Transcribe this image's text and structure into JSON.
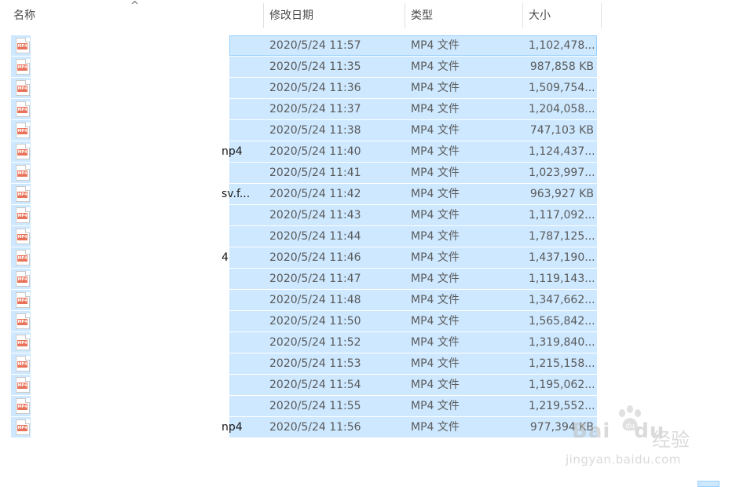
{
  "header": {
    "name": "名称",
    "date": "修改日期",
    "type": "类型",
    "size": "大小",
    "sort_glyph": "^"
  },
  "files": [
    {
      "name": "",
      "date": "2020/5/24 11:57",
      "type": "MP4 文件",
      "size": "1,102,478..."
    },
    {
      "name": "",
      "date": "2020/5/24 11:35",
      "type": "MP4 文件",
      "size": "987,858 KB"
    },
    {
      "name": "",
      "date": "2020/5/24 11:36",
      "type": "MP4 文件",
      "size": "1,509,754..."
    },
    {
      "name": "",
      "date": "2020/5/24 11:37",
      "type": "MP4 文件",
      "size": "1,204,058..."
    },
    {
      "name": "",
      "date": "2020/5/24 11:38",
      "type": "MP4 文件",
      "size": "747,103 KB"
    },
    {
      "name": "np4",
      "date": "2020/5/24 11:40",
      "type": "MP4 文件",
      "size": "1,124,437..."
    },
    {
      "name": "",
      "date": "2020/5/24 11:41",
      "type": "MP4 文件",
      "size": "1,023,997..."
    },
    {
      "name": "sv.f...",
      "date": "2020/5/24 11:42",
      "type": "MP4 文件",
      "size": "963,927 KB"
    },
    {
      "name": "",
      "date": "2020/5/24 11:43",
      "type": "MP4 文件",
      "size": "1,117,092..."
    },
    {
      "name": "",
      "date": "2020/5/24 11:44",
      "type": "MP4 文件",
      "size": "1,787,125..."
    },
    {
      "name": "4",
      "date": "2020/5/24 11:46",
      "type": "MP4 文件",
      "size": "1,437,190..."
    },
    {
      "name": "",
      "date": "2020/5/24 11:47",
      "type": "MP4 文件",
      "size": "1,119,143..."
    },
    {
      "name": "",
      "date": "2020/5/24 11:48",
      "type": "MP4 文件",
      "size": "1,347,662..."
    },
    {
      "name": "",
      "date": "2020/5/24 11:50",
      "type": "MP4 文件",
      "size": "1,565,842..."
    },
    {
      "name": "",
      "date": "2020/5/24 11:52",
      "type": "MP4 文件",
      "size": "1,319,840..."
    },
    {
      "name": "",
      "date": "2020/5/24 11:53",
      "type": "MP4 文件",
      "size": "1,215,158..."
    },
    {
      "name": "",
      "date": "2020/5/24 11:54",
      "type": "MP4 文件",
      "size": "1,195,062..."
    },
    {
      "name": "",
      "date": "2020/5/24 11:55",
      "type": "MP4 文件",
      "size": "1,219,552..."
    },
    {
      "name": "np4",
      "date": "2020/5/24 11:56",
      "type": "MP4 文件",
      "size": "977,394 KB"
    }
  ],
  "icon_label": "MP4",
  "watermark": {
    "logo": "Bai",
    "logo_suffix": "du",
    "brand": "经验",
    "url": "jingyan.baidu.com"
  },
  "colors": {
    "selection": "#cde8ff",
    "selection_border": "#99d1ff",
    "mp4_icon": "#e8735a"
  }
}
